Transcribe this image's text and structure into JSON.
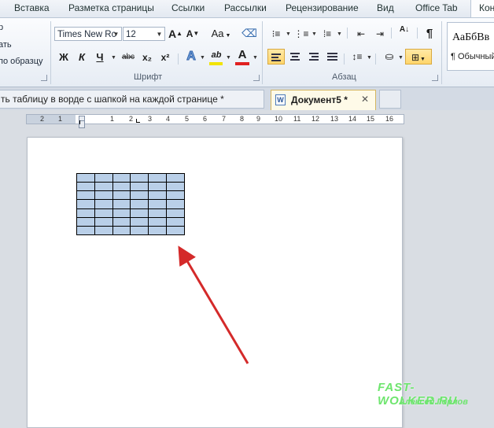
{
  "ribbon_tabs": [
    {
      "id": "insert",
      "label": "Вставка"
    },
    {
      "id": "layout",
      "label": "Разметка страницы"
    },
    {
      "id": "references",
      "label": "Ссылки"
    },
    {
      "id": "mailings",
      "label": "Рассылки"
    },
    {
      "id": "review",
      "label": "Рецензирование"
    },
    {
      "id": "view",
      "label": "Вид"
    },
    {
      "id": "officetab",
      "label": "Office Tab"
    },
    {
      "id": "constructor",
      "label": "Кон"
    }
  ],
  "clipboard": {
    "paste_label": "р",
    "copy_label": "ать",
    "format_painter_label": "по образцу"
  },
  "font": {
    "group_label": "Шрифт",
    "name": "Times New Rc",
    "size": "12",
    "grow": "A",
    "shrink": "A",
    "change_case": "Aa",
    "bold": "Ж",
    "italic": "К",
    "underline": "Ч",
    "strike": "abc",
    "subscript": "x₂",
    "superscript": "x²",
    "effects": "A",
    "highlight": "ab",
    "font_color": "A",
    "highlight_color": "#f2e400",
    "font_color_value": "#e02020"
  },
  "paragraph": {
    "group_label": "Абзац",
    "pilcrow": "¶",
    "sort": "А↓"
  },
  "styles": {
    "sample_text": "АаБбВв",
    "normal_label": "¶ Обычный"
  },
  "doc_tabs": [
    {
      "id": "doc1",
      "title": "ть таблицу в ворде с шапкой на каждой странице *"
    },
    {
      "id": "doc2",
      "title": "Документ5 *",
      "close": "✕"
    }
  ],
  "ruler": {
    "labels": [
      "2",
      "1",
      "1",
      "2",
      "3",
      "4",
      "5",
      "6",
      "7",
      "8",
      "9",
      "10",
      "11",
      "12",
      "13",
      "14",
      "15",
      "16",
      "17"
    ]
  },
  "table": {
    "rows": 7,
    "cols": 6
  },
  "watermark": {
    "site": "FAST-WOLKER.RU",
    "author": "Алексей Горлов"
  },
  "colors": {
    "arrow": "#d42a2a",
    "table_fill": "#b9cfe8",
    "accent": "#2b579a"
  }
}
